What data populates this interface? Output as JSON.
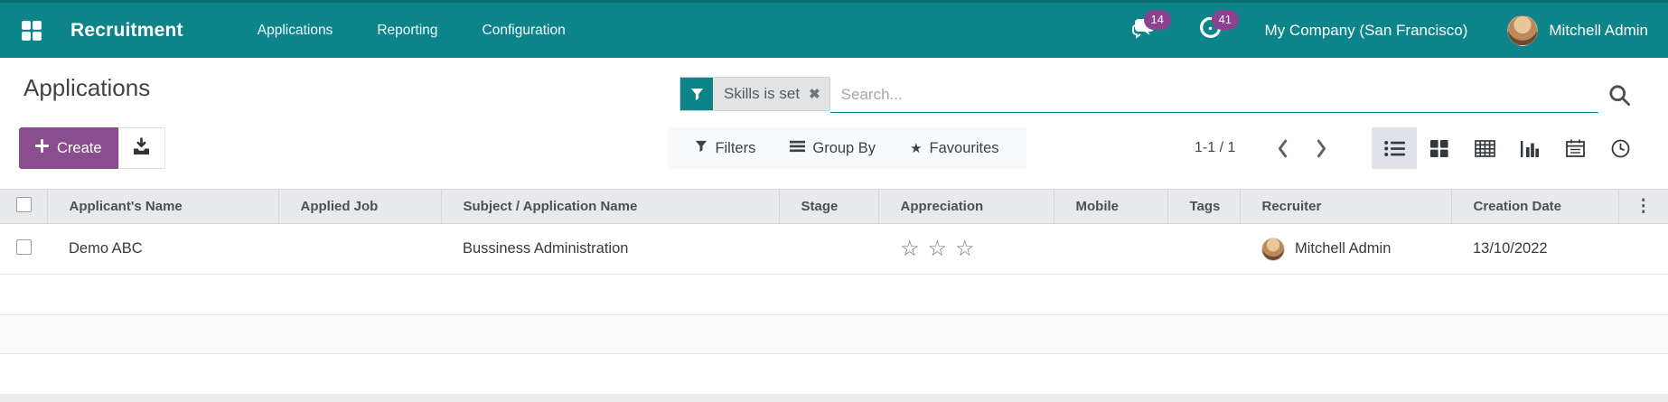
{
  "colors": {
    "navbar_teal": "#0d848a",
    "primary_purple": "#8a4d8e",
    "badge_purple": "#8a4291"
  },
  "nav": {
    "brand": "Recruitment",
    "menus": [
      {
        "label": "Applications"
      },
      {
        "label": "Reporting"
      },
      {
        "label": "Configuration"
      }
    ],
    "messages_badge": "14",
    "activities_badge": "41",
    "company": "My Company (San Francisco)",
    "user_name": "Mitchell Admin"
  },
  "control_panel": {
    "title": "Applications",
    "create_label": "Create",
    "search": {
      "facet_label": "Skills is set",
      "placeholder": "Search..."
    },
    "filters_label": "Filters",
    "group_by_label": "Group By",
    "favourites_label": "Favourites",
    "pager_text": "1-1 / 1"
  },
  "table": {
    "columns": [
      "Applicant's Name",
      "Applied Job",
      "Subject / Application Name",
      "Stage",
      "Appreciation",
      "Mobile",
      "Tags",
      "Recruiter",
      "Creation Date"
    ],
    "rows": [
      {
        "applicant_name": "Demo ABC",
        "applied_job": "",
        "subject": "Bussiness Administration",
        "stage": "",
        "appreciation_empty_stars": 3,
        "mobile": "",
        "tags": "",
        "recruiter": "Mitchell Admin",
        "creation_date": "13/10/2022"
      }
    ]
  },
  "icons": {
    "close": "✖",
    "dots": "⋮",
    "star_filled": "★",
    "star_empty": "☆"
  }
}
